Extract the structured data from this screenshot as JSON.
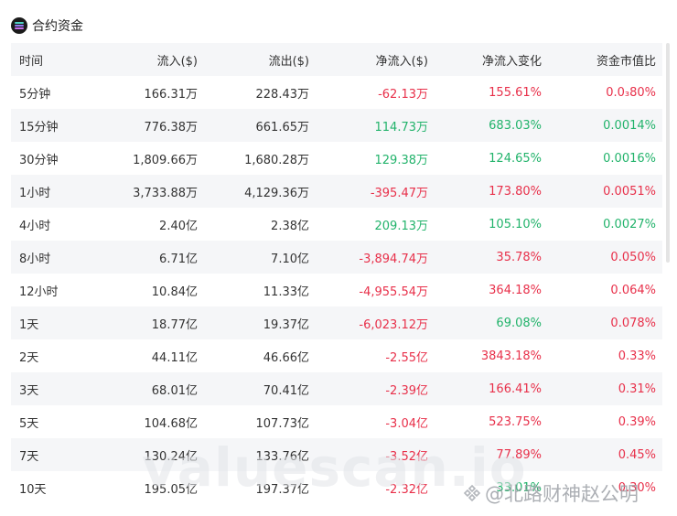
{
  "header": {
    "title": "合约资金",
    "icon": "solana-logo-icon"
  },
  "table": {
    "columns": [
      "时间",
      "流入($)",
      "流出($)",
      "净流入($)",
      "净流入变化",
      "资金市值比"
    ],
    "rows": [
      {
        "period": "5分钟",
        "inflow": "166.31万",
        "outflow": "228.43万",
        "net": "-62.13万",
        "net_sign": "neg",
        "change": "155.61%",
        "change_sign": "neg",
        "ratio": "0.0₃80%",
        "ratio_sign": "neg"
      },
      {
        "period": "15分钟",
        "inflow": "776.38万",
        "outflow": "661.65万",
        "net": "114.73万",
        "net_sign": "pos",
        "change": "683.03%",
        "change_sign": "pos",
        "ratio": "0.0014%",
        "ratio_sign": "pos"
      },
      {
        "period": "30分钟",
        "inflow": "1,809.66万",
        "outflow": "1,680.28万",
        "net": "129.38万",
        "net_sign": "pos",
        "change": "124.65%",
        "change_sign": "pos",
        "ratio": "0.0016%",
        "ratio_sign": "pos"
      },
      {
        "period": "1小时",
        "inflow": "3,733.88万",
        "outflow": "4,129.36万",
        "net": "-395.47万",
        "net_sign": "neg",
        "change": "173.80%",
        "change_sign": "neg",
        "ratio": "0.0051%",
        "ratio_sign": "neg"
      },
      {
        "period": "4小时",
        "inflow": "2.40亿",
        "outflow": "2.38亿",
        "net": "209.13万",
        "net_sign": "pos",
        "change": "105.10%",
        "change_sign": "pos",
        "ratio": "0.0027%",
        "ratio_sign": "pos"
      },
      {
        "period": "8小时",
        "inflow": "6.71亿",
        "outflow": "7.10亿",
        "net": "-3,894.74万",
        "net_sign": "neg",
        "change": "35.78%",
        "change_sign": "neg",
        "ratio": "0.050%",
        "ratio_sign": "neg"
      },
      {
        "period": "12小时",
        "inflow": "10.84亿",
        "outflow": "11.33亿",
        "net": "-4,955.54万",
        "net_sign": "neg",
        "change": "364.18%",
        "change_sign": "neg",
        "ratio": "0.064%",
        "ratio_sign": "neg"
      },
      {
        "period": "1天",
        "inflow": "18.77亿",
        "outflow": "19.37亿",
        "net": "-6,023.12万",
        "net_sign": "neg",
        "change": "69.08%",
        "change_sign": "pos",
        "ratio": "0.078%",
        "ratio_sign": "neg"
      },
      {
        "period": "2天",
        "inflow": "44.11亿",
        "outflow": "46.66亿",
        "net": "-2.55亿",
        "net_sign": "neg",
        "change": "3843.18%",
        "change_sign": "neg",
        "ratio": "0.33%",
        "ratio_sign": "neg"
      },
      {
        "period": "3天",
        "inflow": "68.01亿",
        "outflow": "70.41亿",
        "net": "-2.39亿",
        "net_sign": "neg",
        "change": "166.41%",
        "change_sign": "neg",
        "ratio": "0.31%",
        "ratio_sign": "neg"
      },
      {
        "period": "5天",
        "inflow": "104.68亿",
        "outflow": "107.73亿",
        "net": "-3.04亿",
        "net_sign": "neg",
        "change": "523.75%",
        "change_sign": "neg",
        "ratio": "0.39%",
        "ratio_sign": "neg"
      },
      {
        "period": "7天",
        "inflow": "130.24亿",
        "outflow": "133.76亿",
        "net": "-3.52亿",
        "net_sign": "neg",
        "change": "77.89%",
        "change_sign": "neg",
        "ratio": "0.45%",
        "ratio_sign": "neg"
      },
      {
        "period": "10天",
        "inflow": "195.05亿",
        "outflow": "197.37亿",
        "net": "-2.32亿",
        "net_sign": "neg",
        "change": "33.01%",
        "change_sign": "pos",
        "ratio": "0.30%",
        "ratio_sign": "neg"
      }
    ]
  },
  "colors": {
    "negative": "#e8304a",
    "positive": "#22b36b",
    "stripe": "#f5f6f8"
  },
  "watermark": {
    "brand": "valuescan.io",
    "author": "@北路财神赵公明"
  }
}
